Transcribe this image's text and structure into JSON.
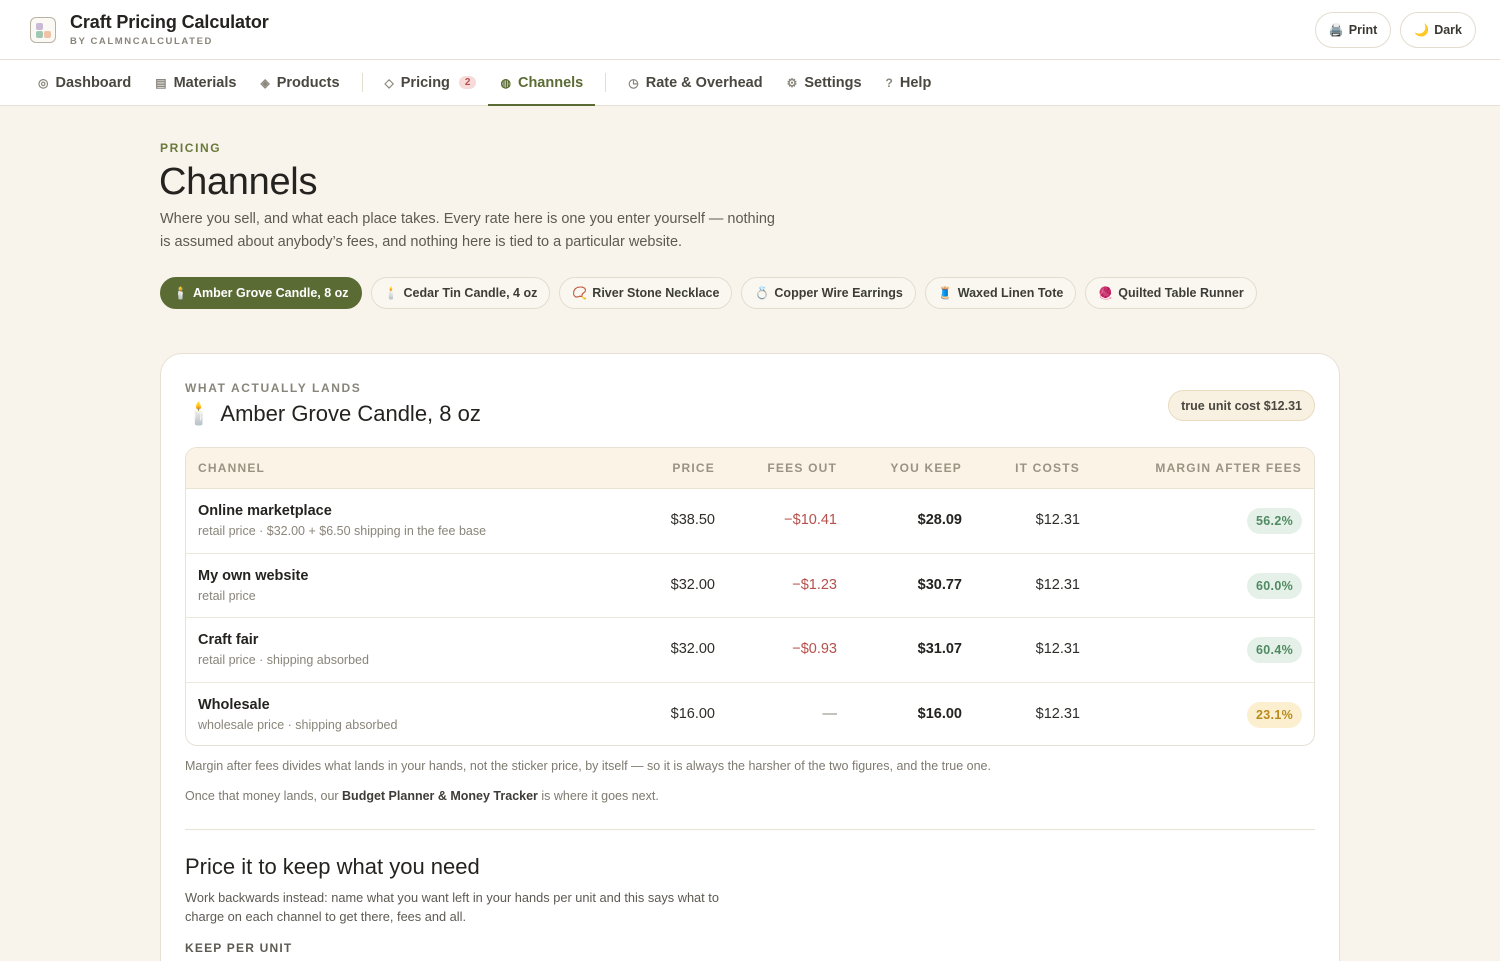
{
  "app": {
    "title": "Craft Pricing Calculator",
    "subtitle": "BY CALMNCALCULATED",
    "print_label": "Print",
    "dark_label": "Dark",
    "accent": "#5b6b34"
  },
  "nav": {
    "dashboard": "Dashboard",
    "materials": "Materials",
    "products": "Products",
    "pricing": "Pricing",
    "pricing_badge": "2",
    "channels": "Channels",
    "rate_overhead": "Rate & Overhead",
    "settings": "Settings",
    "help": "Help"
  },
  "page": {
    "eyebrow": "PRICING",
    "title": "Channels",
    "description": "Where you sell, and what each place takes. Every rate here is one you enter yourself — nothing is assumed about anybody’s fees, and nothing here is tied to a particular website."
  },
  "products": [
    {
      "emoji": "🕯️",
      "name": "Amber Grove Candle, 8 oz"
    },
    {
      "emoji": "🕯️",
      "name": "Cedar Tin Candle, 4 oz"
    },
    {
      "emoji": "📿",
      "name": "River Stone Necklace"
    },
    {
      "emoji": "💍",
      "name": "Copper Wire Earrings"
    },
    {
      "emoji": "🧵",
      "name": "Waxed Linen Tote"
    },
    {
      "emoji": "🧶",
      "name": "Quilted Table Runner"
    }
  ],
  "card": {
    "eyebrow": "WHAT ACTUALLY LANDS",
    "product_emoji": "🕯️",
    "product_name": "Amber Grove Candle, 8 oz",
    "unit_cost": "true unit cost $12.31"
  },
  "table": {
    "headers": {
      "channel": "CHANNEL",
      "price": "PRICE",
      "fees": "FEES OUT",
      "keep": "YOU KEEP",
      "costs": "IT COSTS",
      "margin": "MARGIN AFTER FEES"
    },
    "rows": [
      {
        "name": "Online marketplace",
        "sub": "retail price · $32.00 + $6.50 shipping in the fee base",
        "price": "$38.50",
        "fees": "−$10.41",
        "keep": "$28.09",
        "costs": "$12.31",
        "margin": "56.2%"
      },
      {
        "name": "My own website",
        "sub": "retail price",
        "price": "$32.00",
        "fees": "−$1.23",
        "keep": "$30.77",
        "costs": "$12.31",
        "margin": "60.0%"
      },
      {
        "name": "Craft fair",
        "sub": "retail price · shipping absorbed",
        "price": "$32.00",
        "fees": "−$0.93",
        "keep": "$31.07",
        "costs": "$12.31",
        "margin": "60.4%"
      },
      {
        "name": "Wholesale",
        "sub": "wholesale price · shipping absorbed",
        "price": "$16.00",
        "fees": "—",
        "keep": "$16.00",
        "costs": "$12.31",
        "margin": "23.1%"
      }
    ]
  },
  "notes": {
    "margin_note": "Margin after fees divides what lands in your hands, not the sticker price, by itself — so it is always the harsher of the two figures, and the true one.",
    "budget_prefix": "Once that money lands, our ",
    "budget_link": "Budget Planner & Money Tracker",
    "budget_suffix": " is where it goes next."
  },
  "reverse": {
    "title": "Price it to keep what you need",
    "description": "Work backwards instead: name what you want left in your hands per unit and this says what to charge on each channel to get there, fees and all.",
    "keep_label": "KEEP PER UNIT"
  }
}
